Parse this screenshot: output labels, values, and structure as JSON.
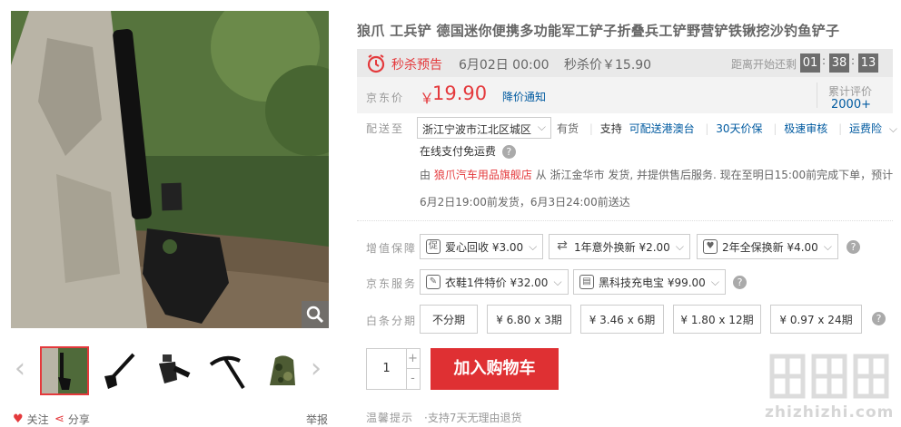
{
  "product": {
    "title": "狼爪 工兵铲 德国迷你便携多功能军工铲子折叠兵工铲野营铲铁锹挖沙钓鱼铲子"
  },
  "flash_sale": {
    "label": "秒杀预告",
    "date": "6月02日 00:00",
    "price_text": "秒杀价￥15.90",
    "countdown_label": "距离开始还剩",
    "hours": "01",
    "minutes": "38",
    "seconds": "13"
  },
  "price": {
    "label": "京东价",
    "currency": "￥",
    "value": "19.90",
    "notify": "降价通知",
    "reviews_label": "累计评价",
    "reviews_count": "2000+"
  },
  "shipping": {
    "label": "配送至",
    "address": "浙江宁波市江北区城区",
    "stock": "有货",
    "supports": "支持",
    "tags": [
      "可配送港澳台",
      "30天价保",
      "极速审核",
      "运费险"
    ],
    "free_ship": "在线支付免运费",
    "seller_prefix": "由",
    "seller_name": "狼爪汽车用品旗舰店",
    "seller_suffix": "从 浙江金华市 发货, 并提供售后服务. 现在至明日15:00前完成下单，预计",
    "delivery": "6月2日19:00前发货，6月3日24:00前送达"
  },
  "value_added": {
    "label": "增值保障",
    "options": [
      {
        "icon": "促",
        "text": "爱心回收 ¥3.00"
      },
      {
        "icon": "⇄",
        "text": "1年意外换新 ¥2.00"
      },
      {
        "icon": "♥",
        "text": "2年全保换新 ¥4.00"
      }
    ]
  },
  "jd_service": {
    "label": "京东服务",
    "options": [
      {
        "icon": "✎",
        "text": "衣鞋1件特价 ¥32.00"
      },
      {
        "icon": "▤",
        "text": "黑科技充电宝 ¥99.00"
      }
    ]
  },
  "installments": {
    "label": "白条分期",
    "options": [
      "不分期",
      "¥ 6.80 x 3期",
      "¥ 3.46 x 6期",
      "¥ 1.80 x 12期",
      "¥ 0.97 x 24期"
    ]
  },
  "purchase": {
    "quantity": "1",
    "plus": "+",
    "minus": "-",
    "add_to_cart": "加入购物车"
  },
  "tips": {
    "label": "温馨提示",
    "text": "·支持7天无理由退货"
  },
  "gallery": {
    "follow": "关注",
    "share": "分享",
    "report": "举报"
  },
  "watermark": {
    "site": "zhizhizhi.com"
  },
  "colors": {
    "accent_red": "#e4393c",
    "link_blue": "#005aa0",
    "cart_red": "#df3033"
  }
}
